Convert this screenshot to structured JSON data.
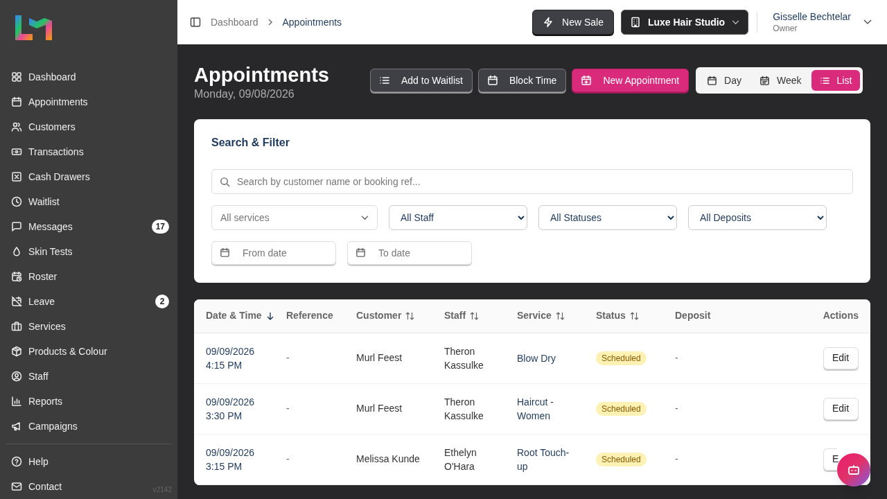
{
  "sidebar": {
    "nav": [
      {
        "label": "Dashboard"
      },
      {
        "label": "Appointments"
      },
      {
        "label": "Customers"
      },
      {
        "label": "Transactions"
      },
      {
        "label": "Cash Drawers"
      },
      {
        "label": "Waitlist"
      },
      {
        "label": "Messages",
        "badge": "17"
      },
      {
        "label": "Skin Tests"
      },
      {
        "label": "Roster"
      },
      {
        "label": "Leave",
        "badge": "2"
      },
      {
        "label": "Services"
      },
      {
        "label": "Products & Colour"
      },
      {
        "label": "Staff"
      },
      {
        "label": "Reports"
      },
      {
        "label": "Campaigns"
      }
    ],
    "footer": [
      {
        "label": "Help"
      },
      {
        "label": "Contact"
      }
    ],
    "version": "v2142"
  },
  "breadcrumb": [
    "Dashboard",
    "Appointments"
  ],
  "topbar": {
    "new_sale": "New Sale",
    "studio": "Luxe Hair Studio",
    "user_name": "Gisselle Bechtelar",
    "user_role": "Owner"
  },
  "page": {
    "title": "Appointments",
    "date": "Monday, 09/08/2026",
    "actions": [
      {
        "label": "Add to Waitlist",
        "kind": "secondary"
      },
      {
        "label": "Block Time",
        "kind": "secondary"
      },
      {
        "label": "New Appointment",
        "kind": "primary"
      }
    ],
    "views": [
      {
        "label": "Day",
        "selected": false
      },
      {
        "label": "Week",
        "selected": false
      },
      {
        "label": "List",
        "selected": true
      }
    ]
  },
  "filter": {
    "title": "Search & Filter",
    "search_placeholder": "Search by customer name or booking ref...",
    "selects": [
      {
        "kind": "combo",
        "value": "All services"
      },
      {
        "kind": "select",
        "value": "All Staff"
      },
      {
        "kind": "select",
        "value": "All Statuses"
      },
      {
        "kind": "select",
        "value": "All Deposits"
      }
    ],
    "dates": [
      {
        "placeholder": "From date"
      },
      {
        "placeholder": "To date"
      }
    ]
  },
  "table": {
    "columns": [
      {
        "label": "Date & Time",
        "kind": "sorted"
      },
      {
        "label": "Reference",
        "kind": "plain"
      },
      {
        "label": "Customer",
        "kind": "sortable"
      },
      {
        "label": "Staff",
        "kind": "sortable"
      },
      {
        "label": "Service",
        "kind": "sortable"
      },
      {
        "label": "Status",
        "kind": "sortable"
      },
      {
        "label": "Deposit",
        "kind": "plain"
      },
      {
        "label": "Actions",
        "kind": "plain"
      }
    ],
    "rows": [
      {
        "date": "09/09/2026",
        "time": "4:15 PM",
        "reference": "-",
        "customer": "Murl Feest",
        "staff": "Theron Kassulke",
        "service": "Blow Dry",
        "status": "Scheduled",
        "deposit": "-",
        "action": "Edit"
      },
      {
        "date": "09/09/2026",
        "time": "3:30 PM",
        "reference": "-",
        "customer": "Murl Feest",
        "staff": "Theron Kassulke",
        "service": "Haircut - Women",
        "status": "Scheduled",
        "deposit": "-",
        "action": "Edit"
      },
      {
        "date": "09/09/2026",
        "time": "3:15 PM",
        "reference": "-",
        "customer": "Melissa Kunde",
        "staff": "Ethelyn O'Hara",
        "service": "Root Touch-up",
        "status": "Scheduled",
        "deposit": "-",
        "action": "E",
        "kind": "covered"
      }
    ]
  }
}
